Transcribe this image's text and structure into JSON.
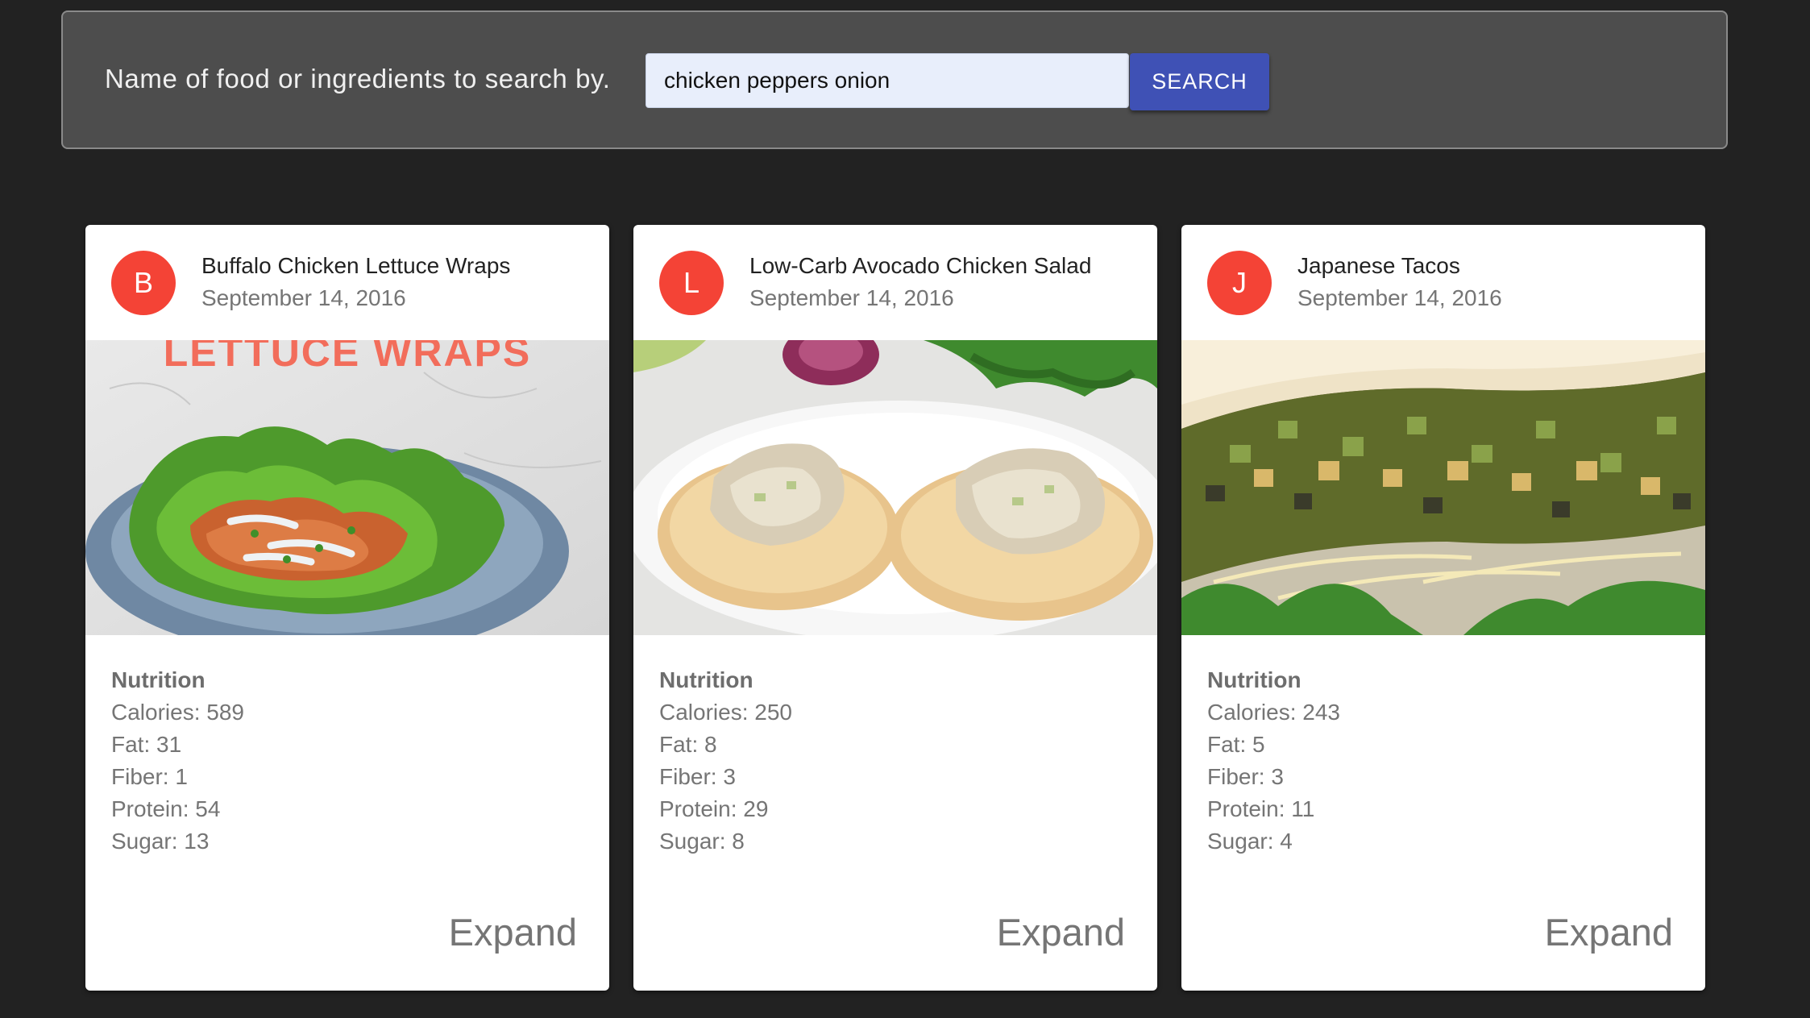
{
  "search": {
    "label": "Name of food or ingredients to search by.",
    "value": "chicken peppers onion",
    "button_label": "SEARCH"
  },
  "colors": {
    "background": "#222222",
    "panel": "#4d4d4d",
    "button": "#3f51b5",
    "avatar": "#f44336"
  },
  "recipes": [
    {
      "avatar_letter": "B",
      "title": "Buffalo Chicken Lettuce Wraps",
      "date": "September 14, 2016",
      "image_text": "LETTUCE WRAPS",
      "nutrition_heading": "Nutrition",
      "calories": "Calories: 589",
      "fat": "Fat: 31",
      "fiber": "Fiber: 1",
      "protein": "Protein: 54",
      "sugar": "Sugar: 13",
      "expand_label": "Expand"
    },
    {
      "avatar_letter": "L",
      "title": "Low-Carb Avocado Chicken Salad",
      "date": "September 14, 2016",
      "nutrition_heading": "Nutrition",
      "calories": "Calories: 250",
      "fat": "Fat: 8",
      "fiber": "Fiber: 3",
      "protein": "Protein: 29",
      "sugar": "Sugar: 8",
      "expand_label": "Expand"
    },
    {
      "avatar_letter": "J",
      "title": "Japanese Tacos",
      "date": "September 14, 2016",
      "nutrition_heading": "Nutrition",
      "calories": "Calories: 243",
      "fat": "Fat: 5",
      "fiber": "Fiber: 3",
      "protein": "Protein: 11",
      "sugar": "Sugar: 4",
      "expand_label": "Expand"
    }
  ]
}
